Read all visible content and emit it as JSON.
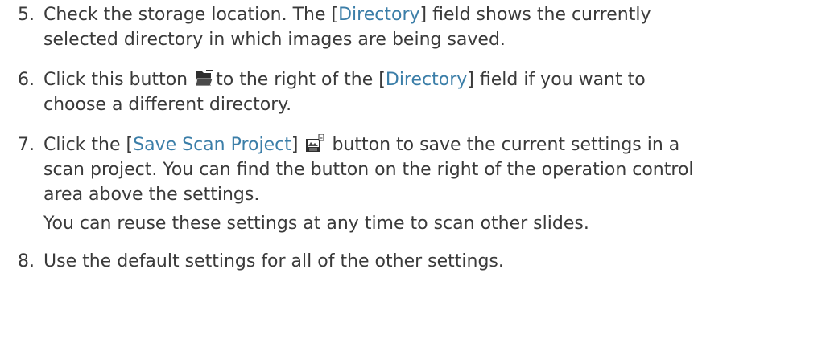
{
  "steps": [
    {
      "number": "5.",
      "lines": [
        {
          "a": "Check the storage location. The [",
          "link": "Directory",
          "b": "] field shows the currently"
        },
        {
          "a": "selected directory in which images are being saved."
        }
      ]
    },
    {
      "number": "6.",
      "lines": [
        {
          "a": "Click this button",
          "icon": "folder-open-icon",
          "b": "to the right of the [",
          "link": "Directory",
          "c": "] field if you want to"
        },
        {
          "a": "choose a different directory."
        }
      ]
    },
    {
      "number": "7.",
      "lines": [
        {
          "a": "Click the [",
          "link": "Save Scan Project",
          "b": "]",
          "icon": "save-scan-project-icon",
          "c": "button to save the current settings in a"
        },
        {
          "a": "scan project. You can find the button on the right of the operation control"
        },
        {
          "a": "area above the settings."
        }
      ]
    },
    {
      "number": "8.",
      "lines": [
        {
          "a": "Use the default settings for all of the other settings."
        }
      ]
    }
  ],
  "note": "You can reuse these settings at any time to scan other slides.",
  "colors": {
    "text": "#3a3a3a",
    "link": "#3b7ea8",
    "icon_dark": "#2f2f2f"
  }
}
